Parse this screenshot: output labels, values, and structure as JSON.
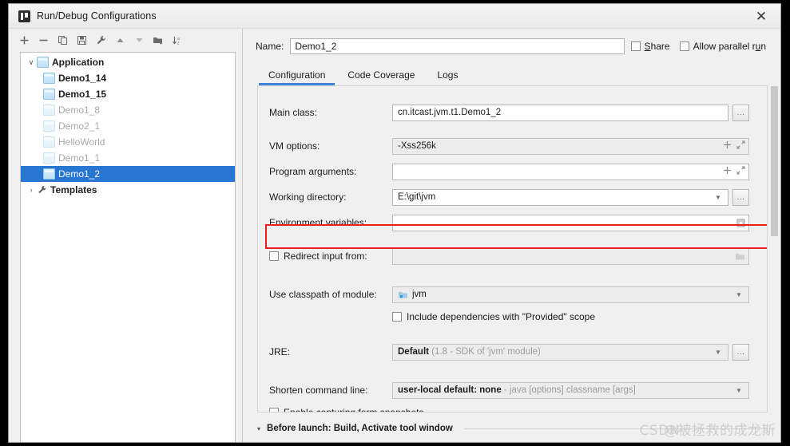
{
  "window": {
    "title": "Run/Debug Configurations",
    "close_label": "✕",
    "app_icon": "idea-icon"
  },
  "toolbar": {
    "buttons": [
      {
        "name": "add-configuration-button",
        "icon": "plus-icon",
        "tooltip": "Add New Configuration"
      },
      {
        "name": "remove-configuration-button",
        "icon": "minus-icon",
        "tooltip": "Remove Configuration"
      },
      {
        "name": "copy-configuration-button",
        "icon": "copy-icon",
        "tooltip": "Copy Configuration"
      },
      {
        "name": "save-configuration-button",
        "icon": "save-icon",
        "tooltip": "Save Configuration"
      },
      {
        "name": "edit-templates-button",
        "icon": "wrench-icon",
        "tooltip": "Edit Templates"
      },
      {
        "name": "move-up-button",
        "icon": "arrow-up-icon",
        "tooltip": "Move Up"
      },
      {
        "name": "move-down-button",
        "icon": "arrow-down-icon",
        "tooltip": "Move Down"
      },
      {
        "name": "new-folder-button",
        "icon": "folder-add-icon",
        "tooltip": "Create New Folder"
      },
      {
        "name": "sort-configurations-button",
        "icon": "sort-az-icon",
        "tooltip": "Sort Configurations"
      }
    ]
  },
  "tree": {
    "items": [
      {
        "label": "Application",
        "level": 0,
        "twisty": "∨",
        "icon": "application-icon",
        "bold": true,
        "dim": false,
        "selected": false
      },
      {
        "label": "Demo1_14",
        "level": 1,
        "twisty": "",
        "icon": "application-icon",
        "bold": true,
        "dim": false,
        "selected": false
      },
      {
        "label": "Demo1_15",
        "level": 1,
        "twisty": "",
        "icon": "application-icon",
        "bold": true,
        "dim": false,
        "selected": false
      },
      {
        "label": "Demo1_8",
        "level": 1,
        "twisty": "",
        "icon": "application-icon",
        "bold": false,
        "dim": true,
        "selected": false
      },
      {
        "label": "Demo2_1",
        "level": 1,
        "twisty": "",
        "icon": "application-icon",
        "bold": false,
        "dim": true,
        "selected": false
      },
      {
        "label": "HelloWorld",
        "level": 1,
        "twisty": "",
        "icon": "application-icon",
        "bold": false,
        "dim": true,
        "selected": false
      },
      {
        "label": "Demo1_1",
        "level": 1,
        "twisty": "",
        "icon": "application-icon",
        "bold": false,
        "dim": true,
        "selected": false
      },
      {
        "label": "Demo1_2",
        "level": 1,
        "twisty": "",
        "icon": "application-icon",
        "bold": false,
        "dim": false,
        "selected": true
      },
      {
        "label": "Templates",
        "level": 0,
        "twisty": "›",
        "icon": "wrench-icon",
        "bold": true,
        "dim": false,
        "selected": false
      }
    ]
  },
  "header": {
    "name_label": "Name:",
    "name_value": "Demo1_2",
    "share_label": "Share",
    "share_mnemonic": "S",
    "share_checked": false,
    "parallel_label": "Allow parallel run",
    "parallel_mnemonic": "u",
    "parallel_checked": false
  },
  "tabs": [
    {
      "label": "Configuration",
      "active": true
    },
    {
      "label": "Code Coverage",
      "active": false
    },
    {
      "label": "Logs",
      "active": false
    }
  ],
  "form": {
    "main_class": {
      "label": "Main class:",
      "value": "cn.itcast.jvm.t1.Demo1_2",
      "browse": "..."
    },
    "vm_options": {
      "label": "VM options:",
      "value": "-Xss256k",
      "add_icon": "plus-icon",
      "expand_icon": "expand-icon"
    },
    "program_arguments": {
      "label": "Program arguments:",
      "value": "",
      "add_icon": "plus-icon",
      "expand_icon": "expand-icon"
    },
    "working_directory": {
      "label": "Working directory:",
      "value": "E:\\git\\jvm",
      "browse": "...",
      "dropdown_icon": "chevron-down-icon"
    },
    "environment_variables": {
      "label": "Environment variables:",
      "value": "",
      "browse_icon": "browse-icon"
    },
    "redirect_input": {
      "label": "Redirect input from:",
      "checked": false,
      "value": "",
      "folder_icon": "folder-icon"
    },
    "use_classpath": {
      "label": "Use classpath of module:",
      "value": "jvm",
      "module_icon": "module-icon",
      "dropdown_icon": "chevron-down-icon"
    },
    "include_dependencies": {
      "label": "Include dependencies with \"Provided\" scope",
      "checked": false
    },
    "jre": {
      "label": "JRE:",
      "value": "Default",
      "hint": "(1.8 - SDK of 'jvm' module)",
      "browse": "...",
      "dropdown_icon": "chevron-down-icon"
    },
    "shorten_command_line": {
      "label": "Shorten command line:",
      "value": "user-local default: none",
      "hint": "- java [options] classname [args]",
      "dropdown_icon": "chevron-down-icon"
    },
    "form_snapshots": {
      "label": "Enable capturing form snapshots",
      "mnemonic": "E",
      "checked": false
    }
  },
  "before_launch": {
    "twisty": "▾",
    "text": "Before launch: Build, Activate tool window"
  },
  "watermark": {
    "prefix": "CSDN",
    "handle": "@被拯救的成龙斯"
  },
  "colors": {
    "accent": "#3a85d8",
    "selection": "#2776d2",
    "highlight": "#ee1c1c",
    "window_bg": "#f0f0f0"
  }
}
